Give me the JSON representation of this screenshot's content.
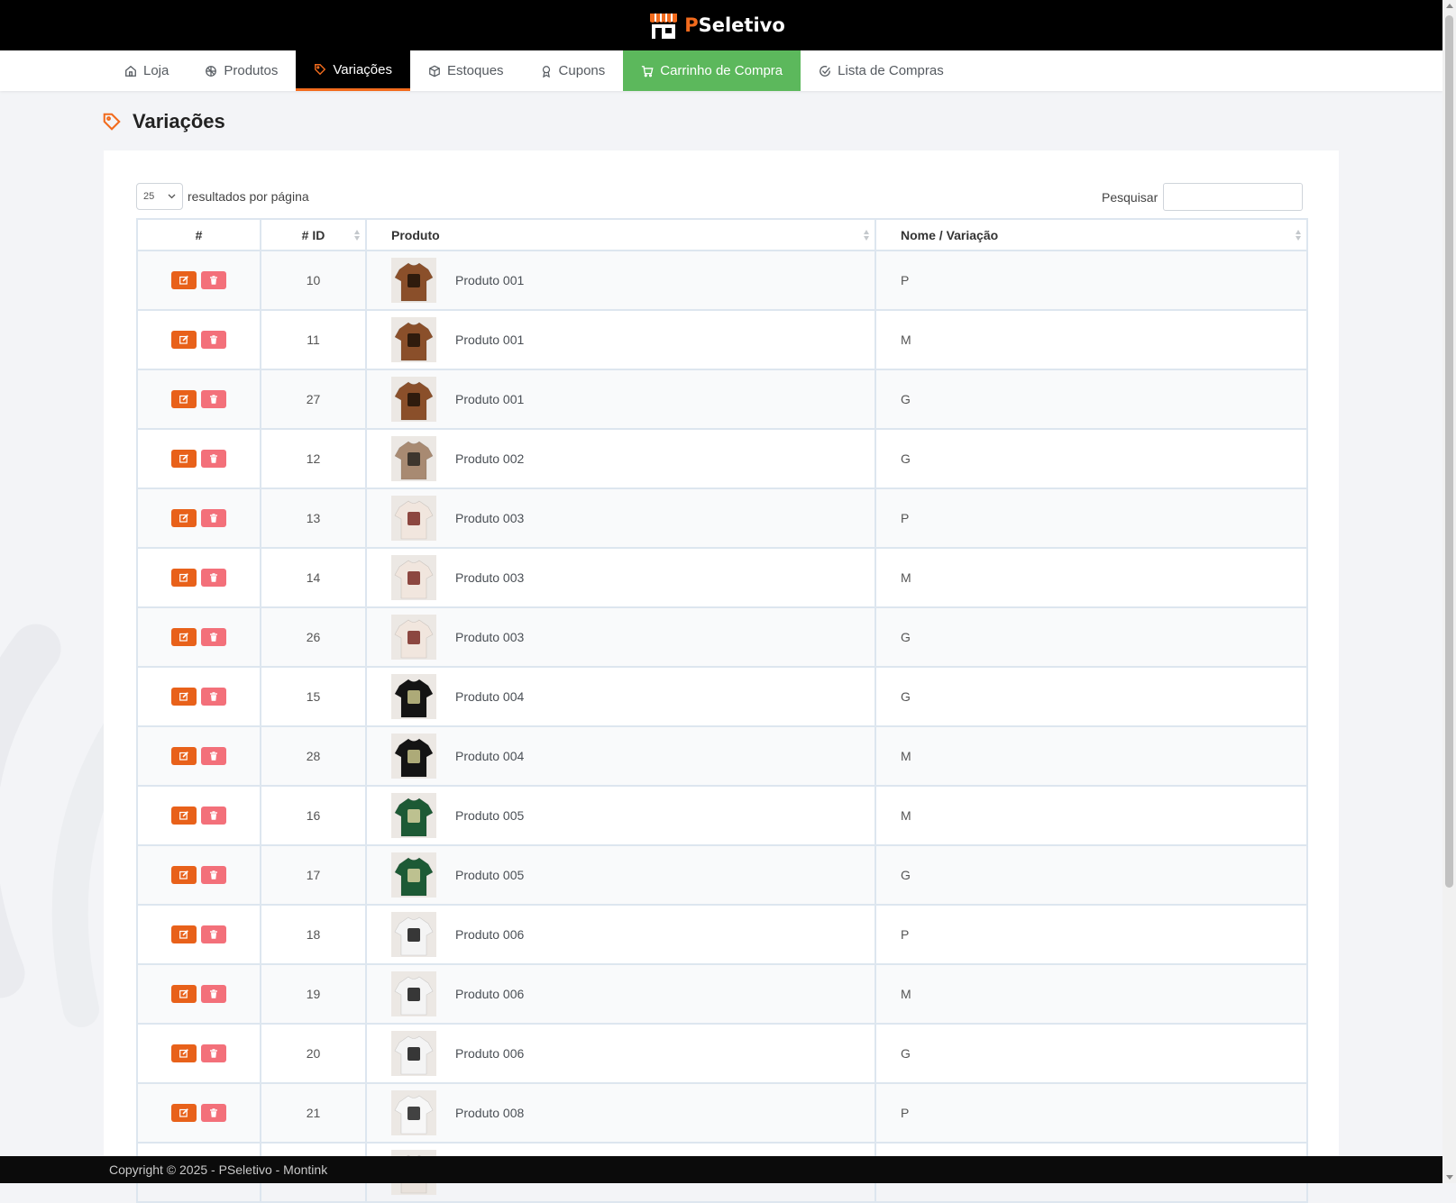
{
  "brand": {
    "prefix": "P",
    "name": "Seletivo"
  },
  "nav": [
    {
      "label": "Loja",
      "icon": "home-icon",
      "state": "normal"
    },
    {
      "label": "Produtos",
      "icon": "box-icon",
      "state": "normal"
    },
    {
      "label": "Variações",
      "icon": "tag-icon",
      "state": "active"
    },
    {
      "label": "Estoques",
      "icon": "cube-icon",
      "state": "normal"
    },
    {
      "label": "Cupons",
      "icon": "award-icon",
      "state": "normal"
    },
    {
      "label": "Carrinho de Compra",
      "icon": "cart-icon",
      "state": "highlight"
    },
    {
      "label": "Lista de Compras",
      "icon": "check-circle-icon",
      "state": "normal"
    }
  ],
  "page": {
    "title": "Variações"
  },
  "table_controls": {
    "page_length": "25",
    "page_length_label": "resultados por página",
    "search_label": "Pesquisar",
    "search_value": ""
  },
  "table": {
    "headers": {
      "actions": "#",
      "id": "# ID",
      "product": "Produto",
      "variation": "Nome / Variação"
    },
    "rows": [
      {
        "id": "10",
        "product": "Produto 001",
        "variation": "P",
        "shirt_color": "#8a4f2a",
        "print_color": "#1e1208"
      },
      {
        "id": "11",
        "product": "Produto 001",
        "variation": "M",
        "shirt_color": "#8a4f2a",
        "print_color": "#1e1208"
      },
      {
        "id": "27",
        "product": "Produto 001",
        "variation": "G",
        "shirt_color": "#8a4f2a",
        "print_color": "#1e1208"
      },
      {
        "id": "12",
        "product": "Produto 002",
        "variation": "G",
        "shirt_color": "#a88a72",
        "print_color": "#2b2722"
      },
      {
        "id": "13",
        "product": "Produto 003",
        "variation": "P",
        "shirt_color": "#f1e6de",
        "print_color": "#7a2a25"
      },
      {
        "id": "14",
        "product": "Produto 003",
        "variation": "M",
        "shirt_color": "#f1e6de",
        "print_color": "#7a2a25"
      },
      {
        "id": "26",
        "product": "Produto 003",
        "variation": "G",
        "shirt_color": "#f1e6de",
        "print_color": "#7a2a25"
      },
      {
        "id": "15",
        "product": "Produto 004",
        "variation": "G",
        "shirt_color": "#141414",
        "print_color": "#c8c48a"
      },
      {
        "id": "28",
        "product": "Produto 004",
        "variation": "M",
        "shirt_color": "#141414",
        "print_color": "#c8c48a"
      },
      {
        "id": "16",
        "product": "Produto 005",
        "variation": "M",
        "shirt_color": "#1d5a35",
        "print_color": "#d9d3a0"
      },
      {
        "id": "17",
        "product": "Produto 005",
        "variation": "G",
        "shirt_color": "#1d5a35",
        "print_color": "#d9d3a0"
      },
      {
        "id": "18",
        "product": "Produto 006",
        "variation": "P",
        "shirt_color": "#f4f4f4",
        "print_color": "#151515"
      },
      {
        "id": "19",
        "product": "Produto 006",
        "variation": "M",
        "shirt_color": "#f4f4f4",
        "print_color": "#151515"
      },
      {
        "id": "20",
        "product": "Produto 006",
        "variation": "G",
        "shirt_color": "#f4f4f4",
        "print_color": "#151515"
      },
      {
        "id": "21",
        "product": "Produto 008",
        "variation": "P",
        "shirt_color": "#f7f7f7",
        "print_color": "#222222"
      },
      {
        "id": "",
        "product": "",
        "variation": "",
        "shirt_color": "#e9e2dc",
        "print_color": "#5a3a2a"
      }
    ]
  },
  "footer": {
    "text": "Copyright © 2025 - PSeletivo - Montink"
  },
  "colors": {
    "accent": "#f26b1d",
    "edit_button": "#e8611a",
    "delete_button": "#f3707a",
    "cart_tab": "#5cb85c"
  }
}
